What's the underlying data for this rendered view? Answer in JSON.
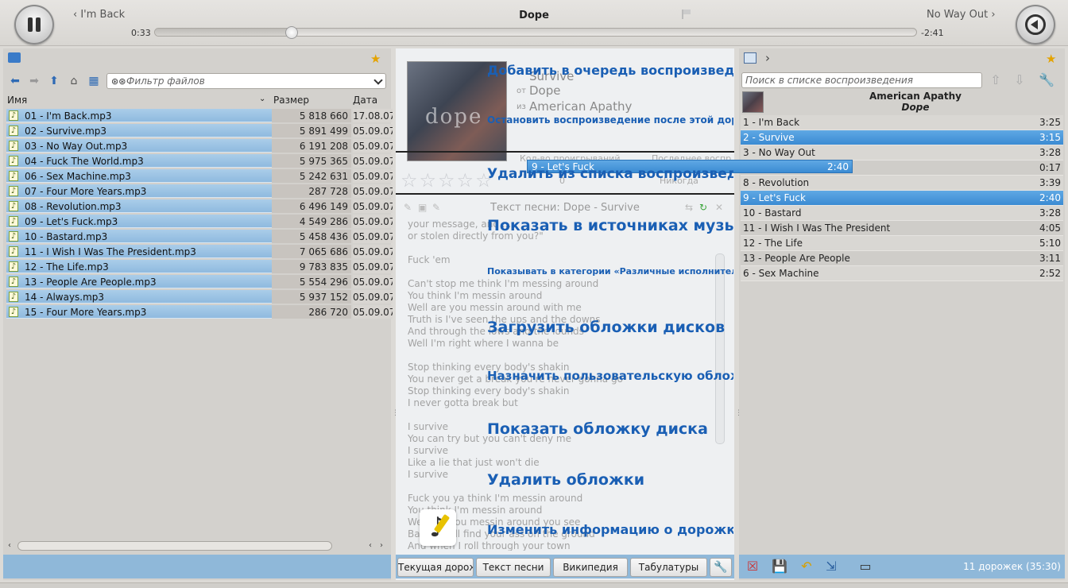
{
  "player": {
    "prev_track": "I'm Back",
    "current_title": "Dope",
    "next_track": "No Way Out",
    "elapsed": "0:33",
    "remaining": "-2:41",
    "progress": 0.18
  },
  "files": {
    "filter_placeholder": "Фильтр файлов",
    "columns": {
      "name": "Имя",
      "size": "Размер",
      "date": "Дата"
    },
    "rows": [
      {
        "name": "01 - I'm Back.mp3",
        "size": "5 818 660",
        "date": "17.08.07"
      },
      {
        "name": "02 - Survive.mp3",
        "size": "5 891 499",
        "date": "05.09.07"
      },
      {
        "name": "03 - No Way Out.mp3",
        "size": "6 191 208",
        "date": "05.09.07"
      },
      {
        "name": "04 - Fuck The World.mp3",
        "size": "5 975 365",
        "date": "05.09.07"
      },
      {
        "name": "06 - Sex Machine.mp3",
        "size": "5 242 631",
        "date": "05.09.07"
      },
      {
        "name": "07 - Four More Years.mp3",
        "size": "287 728",
        "date": "05.09.07"
      },
      {
        "name": "08 - Revolution.mp3",
        "size": "6 496 149",
        "date": "05.09.07"
      },
      {
        "name": "09 - Let's Fuck.mp3",
        "size": "4 549 286",
        "date": "05.09.07"
      },
      {
        "name": "10 - Bastard.mp3",
        "size": "5 458 436",
        "date": "05.09.07"
      },
      {
        "name": "11 - I Wish I Was The President.mp3",
        "size": "7 065 686",
        "date": "05.09.07"
      },
      {
        "name": "12 - The Life.mp3",
        "size": "9 783 835",
        "date": "05.09.07"
      },
      {
        "name": "13 - People Are People.mp3",
        "size": "5 554 296",
        "date": "05.09.07"
      },
      {
        "name": "14 - Always.mp3",
        "size": "5 937 152",
        "date": "05.09.07"
      },
      {
        "name": "15 - Four More Years.mp3",
        "size": "286 720",
        "date": "05.09.07"
      }
    ]
  },
  "context": {
    "art_text": "dope",
    "track_title": "Survive",
    "by_label": "от",
    "artist": "Dope",
    "on_label": "из",
    "album": "American Apathy",
    "play_count_label": "Кол-во проигрываний",
    "last_played_label": "Последнее воспр.",
    "play_count": "0",
    "last_played": "Никогда",
    "lyrics_title": "Текст песни: Dope - Survive",
    "lyrics": "your message, and ...\nor stolen directly from you?\"\n\nFuck 'em\n\nCan't stop me think I'm messing around\nYou think I'm messin around\nWell are you messin around with me\nTruth is I've seen the ups and the downs\nAnd through the lows and the lounds\nWell I'm right where I wanna be\n\nStop thinking every body's shakin\nYou never get a break you're never gonna go\nStop thinking every body's shakin\nI never gotta break but\n\nI survive\nYou can try but you can't deny me\nI survive\nLike a lie that just won't die\nI survive\n\nFuck you ya think I'm messin around\nYou think I'm messin around\nWell are you messin around you see\nBaby you'll find your ass on the ground\nAnd when I roll through your town"
  },
  "context_menu": [
    "Добавить в очередь воспроизведения",
    "Остановить воспроизведение после этой дорожки",
    "Удалить из списка воспроизведения",
    "Показать в источниках музыки",
    "Показывать в категории «Различные исполнители»",
    "Загрузить обложки дисков",
    "Назначить пользовательскую обложку",
    "Показать обложку диска",
    "Удалить обложки",
    "Изменить информацию о дорожке"
  ],
  "dragged_item": {
    "title": "9 - Let's Fuck",
    "duration": "2:40"
  },
  "tabs": [
    "Текущая дорожка",
    "Текст песни",
    "Википедия",
    "Табулатуры"
  ],
  "playlist": {
    "search_placeholder": "Поиск в списке воспроизведения",
    "album": "American Apathy",
    "artist": "Dope",
    "tracks": [
      {
        "title": "1 - I'm Back",
        "duration": "3:25",
        "selected": false
      },
      {
        "title": "2 - Survive",
        "duration": "3:15",
        "selected": true
      },
      {
        "title": "3 - No Way Out",
        "duration": "3:28",
        "selected": false
      },
      {
        "title": "",
        "duration": "0:17",
        "selected": false
      },
      {
        "title": "8 - Revolution",
        "duration": "3:39",
        "selected": false
      },
      {
        "title": "9 - Let's Fuck",
        "duration": "2:40",
        "selected": true
      },
      {
        "title": "10 - Bastard",
        "duration": "3:28",
        "selected": false
      },
      {
        "title": "11 - I Wish I Was The President",
        "duration": "4:05",
        "selected": false
      },
      {
        "title": "12 - The Life",
        "duration": "5:10",
        "selected": false
      },
      {
        "title": "13 - People Are People",
        "duration": "3:11",
        "selected": false
      },
      {
        "title": "6 - Sex Machine",
        "duration": "2:52",
        "selected": false
      }
    ],
    "summary": "11 дорожек (35:30)"
  },
  "icons": {
    "play_pause": "pause-icon",
    "volume": "volume-icon",
    "accent_color": "#1a5fb4",
    "selection_color": "#3b8bd3",
    "footer_color": "#8fb8d9"
  }
}
